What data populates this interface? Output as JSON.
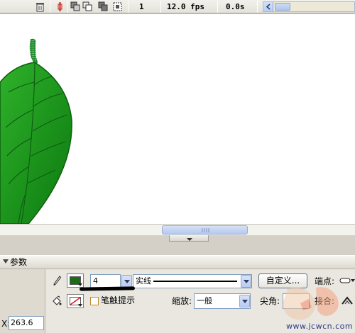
{
  "timeline": {
    "current_frame": "1",
    "frame_rate": "12.0 fps",
    "elapsed_time": "0.0s",
    "icons": [
      "trash-icon",
      "center-frame-icon",
      "onion-skin-icon",
      "onion-skin-outlines-icon",
      "edit-multiple-frames-icon",
      "modify-onion-markers-icon",
      "scroll-left-icon"
    ]
  },
  "panel": {
    "title": "参数",
    "stroke_color": "#1d6b16",
    "stroke_height": "4",
    "stroke_style": "实线",
    "custom_button": "自定义...",
    "cap_label": "端点:",
    "fill_color_none": "none",
    "stroke_hinting_label": "笔触提示",
    "scale_label": "缩放:",
    "scale_value": "一般",
    "sharp_label": "尖角:",
    "join_label": "接合:",
    "x_label": "X:",
    "x_value": "263.6"
  },
  "colors": {
    "leaf_light": "#2fb12a",
    "leaf_dark": "#0c7a10",
    "vein": "#0e5a12",
    "stem": "#1f8a2b"
  },
  "watermark": {
    "url_text": "www.jcwcn.com"
  }
}
